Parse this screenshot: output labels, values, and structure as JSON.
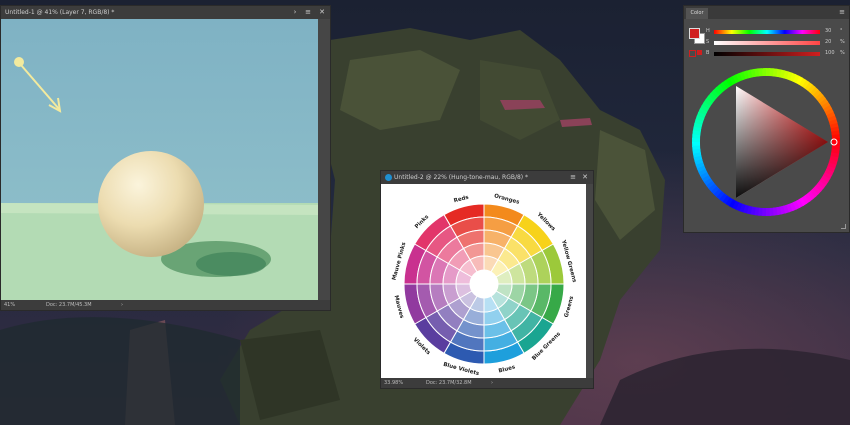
{
  "window1": {
    "title": "Untitled-1 @ 41% (Layer 7, RGB/8) *",
    "zoom": "41%",
    "doc": "Doc: 23.7M/45.3M"
  },
  "window2": {
    "title": "Untitled-2 @ 22% (Hung-tone-mau, RGB/8) *",
    "zoom": "33.98%",
    "doc": "Doc: 23.7M/32.8M"
  },
  "colorPanel": {
    "title": "Color",
    "sliders": [
      {
        "label": "H",
        "value": "30",
        "unit": "°"
      },
      {
        "label": "S",
        "value": "20",
        "unit": "%"
      },
      {
        "label": "B",
        "value": "100",
        "unit": "%"
      }
    ],
    "foreground": "#d01f1f",
    "background": "#ffffff"
  },
  "wheel": {
    "labels": [
      "Reds",
      "Oranges",
      "Yellows",
      "Yellow Greens",
      "Greens",
      "Blue Greens",
      "Blues",
      "Blue Violets",
      "Violets",
      "Mauves",
      "Mauve Pinks",
      "Pinks"
    ],
    "hues": [
      "#e52a24",
      "#f38a1c",
      "#f7d21a",
      "#9cc93a",
      "#37a948",
      "#1aa591",
      "#1e9fdc",
      "#2d5ab1",
      "#5a3d9f",
      "#913a9f",
      "#c9318f",
      "#e2356a"
    ]
  },
  "icons": {
    "close": "✕",
    "collapse": "›",
    "menu": "≡"
  }
}
